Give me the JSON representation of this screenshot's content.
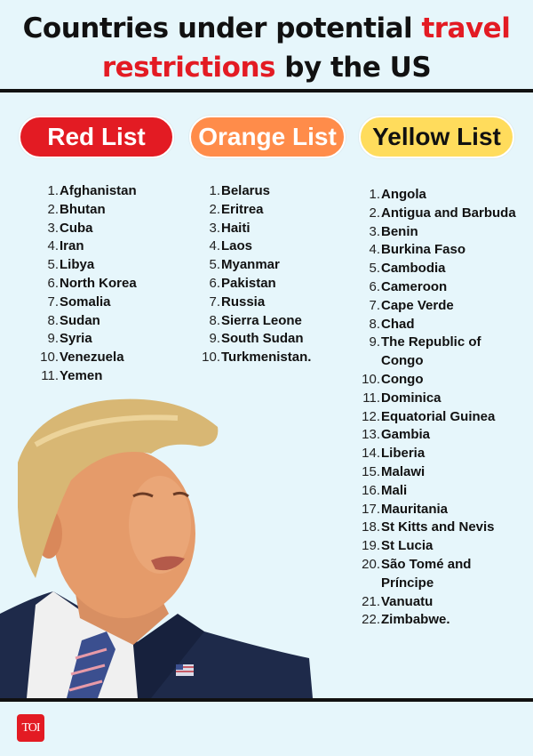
{
  "header": {
    "title_part1": "Countries under potential ",
    "title_highlight1": "travel",
    "title_highlight2": "restrictions",
    "title_part2": " by the US",
    "highlight_color": "#e31b23"
  },
  "lists": {
    "red": {
      "label": "Red List",
      "color": "#e31b23",
      "items": [
        {
          "num": "1.",
          "name": "Afghanistan"
        },
        {
          "num": "2.",
          "name": "Bhutan"
        },
        {
          "num": "3.",
          "name": "Cuba"
        },
        {
          "num": "4.",
          "name": "Iran"
        },
        {
          "num": "5.",
          "name": "Libya"
        },
        {
          "num": "6.",
          "name": "North Korea"
        },
        {
          "num": "7.",
          "name": "Somalia"
        },
        {
          "num": "8.",
          "name": "Sudan"
        },
        {
          "num": "9.",
          "name": "Syria"
        },
        {
          "num": "10.",
          "name": "Venezuela"
        },
        {
          "num": "11.",
          "name": "Yemen"
        }
      ]
    },
    "orange": {
      "label": "Orange List",
      "color": "#ff8c4a",
      "items": [
        {
          "num": "1.",
          "name": "Belarus"
        },
        {
          "num": "2.",
          "name": "Eritrea"
        },
        {
          "num": "3.",
          "name": "Haiti"
        },
        {
          "num": "4.",
          "name": "Laos"
        },
        {
          "num": "5.",
          "name": "Myanmar"
        },
        {
          "num": "6.",
          "name": "Pakistan"
        },
        {
          "num": "7.",
          "name": "Russia"
        },
        {
          "num": "8.",
          "name": "Sierra Leone"
        },
        {
          "num": "9.",
          "name": "South Sudan"
        },
        {
          "num": "10.",
          "name": "Turkmenistan."
        }
      ]
    },
    "yellow": {
      "label": "Yellow List",
      "color": "#ffdc5c",
      "items": [
        {
          "num": "1.",
          "name": "Angola"
        },
        {
          "num": "2.",
          "name": "Antigua and Barbuda"
        },
        {
          "num": "3.",
          "name": "Benin"
        },
        {
          "num": "4.",
          "name": "Burkina Faso"
        },
        {
          "num": "5.",
          "name": "Cambodia"
        },
        {
          "num": "6.",
          "name": "Cameroon"
        },
        {
          "num": "7.",
          "name": "Cape Verde"
        },
        {
          "num": "8.",
          "name": "Chad"
        },
        {
          "num": "9.",
          "name": "The Republic of Congo"
        },
        {
          "num": "10.",
          "name": "Congo"
        },
        {
          "num": "11.",
          "name": "Dominica"
        },
        {
          "num": "12.",
          "name": "Equatorial Guinea"
        },
        {
          "num": "13.",
          "name": "Gambia"
        },
        {
          "num": "14.",
          "name": "Liberia"
        },
        {
          "num": "15.",
          "name": "Malawi"
        },
        {
          "num": "16.",
          "name": "Mali"
        },
        {
          "num": "17.",
          "name": "Mauritania"
        },
        {
          "num": "18.",
          "name": "St Kitts and Nevis"
        },
        {
          "num": "19.",
          "name": "St Lucia"
        },
        {
          "num": "20.",
          "name": "São Tomé and Príncipe"
        },
        {
          "num": "21.",
          "name": "Vanuatu"
        },
        {
          "num": "22.",
          "name": "Zimbabwe."
        }
      ]
    }
  },
  "photo": {
    "subject": "portrait-photo"
  },
  "footer": {
    "logo_text": "TOI"
  }
}
